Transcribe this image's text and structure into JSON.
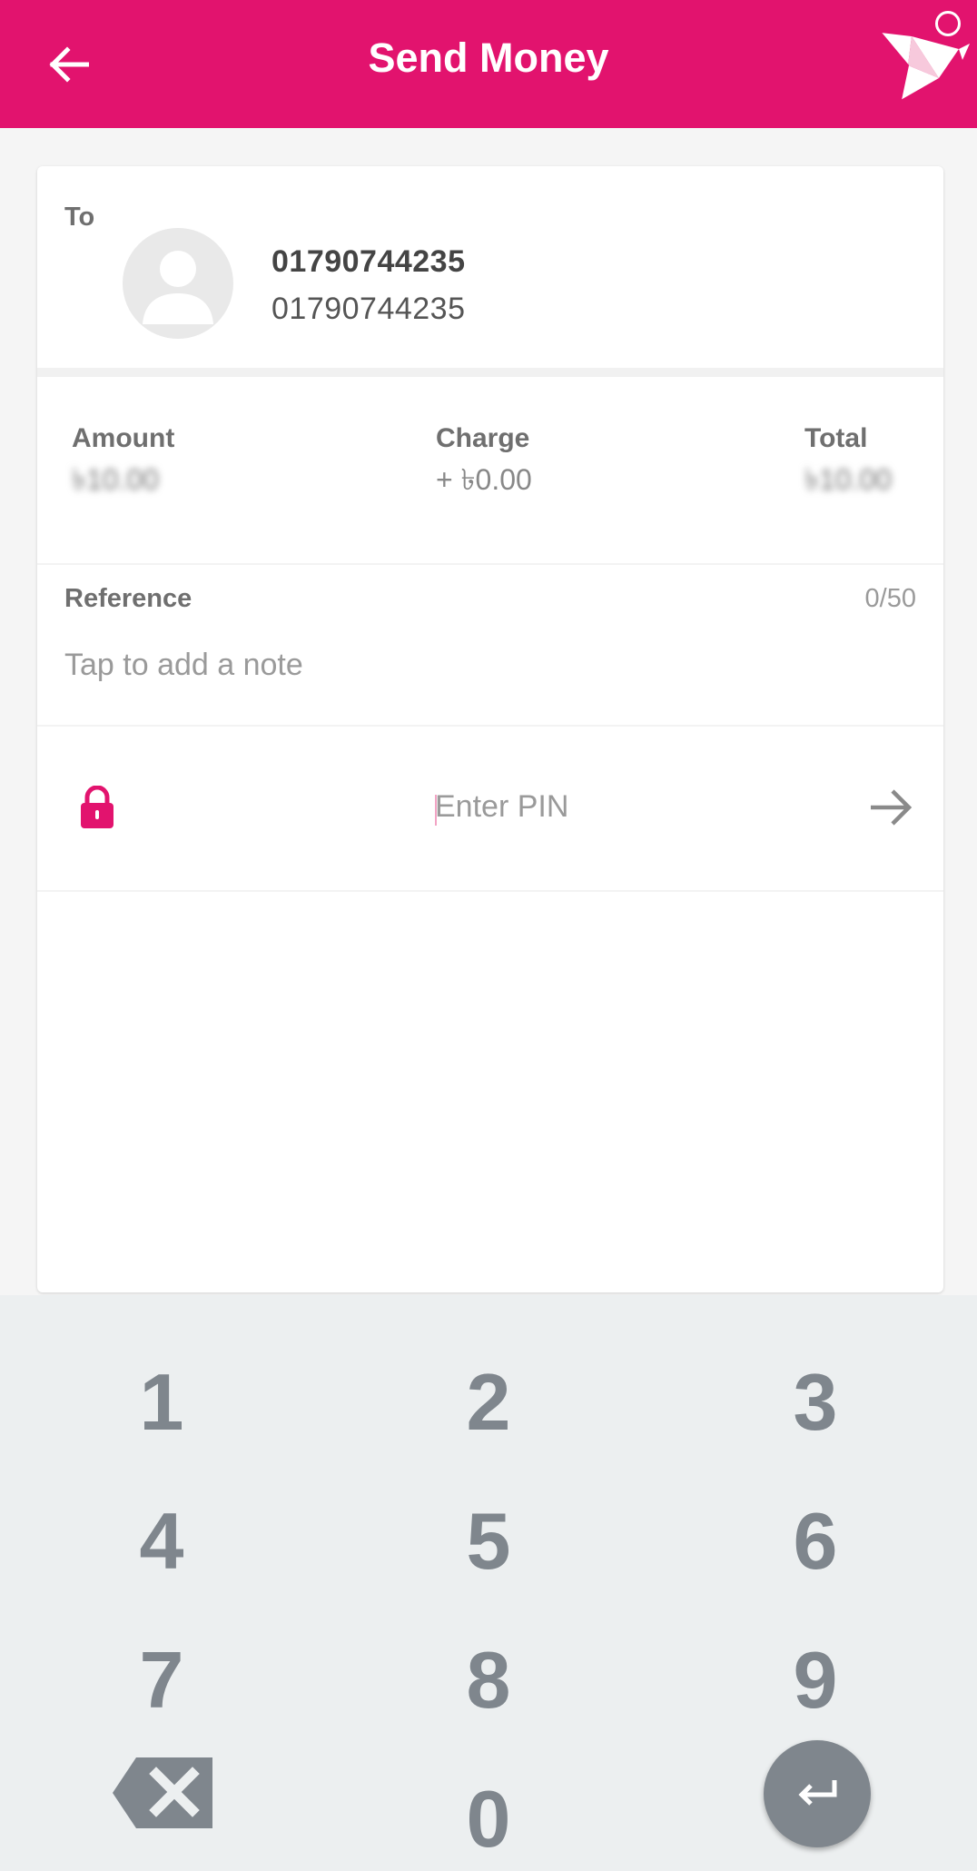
{
  "appbar": {
    "title": "Send Money",
    "back_icon": "arrow-left-icon",
    "logo_icon": "bkash-bird-logo",
    "background": "#e2136e"
  },
  "recipient": {
    "to_label": "To",
    "name": "01790744235",
    "number": "01790744235",
    "avatar_icon": "person-avatar-icon"
  },
  "summary": {
    "amount_label": "Amount",
    "amount_value": "৳10.00",
    "charge_label": "Charge",
    "charge_value": "+ ৳0.00",
    "total_label": "Total",
    "total_value": "৳10.00"
  },
  "reference": {
    "label": "Reference",
    "counter": "0/50",
    "placeholder": "Tap to add a note"
  },
  "pin": {
    "placeholder": "Enter PIN",
    "lock_icon": "lock-icon",
    "submit_icon": "arrow-right-icon",
    "accent": "#e2136e"
  },
  "keypad": {
    "keys": [
      "1",
      "2",
      "3",
      "4",
      "5",
      "6",
      "7",
      "8",
      "9",
      "0"
    ],
    "backspace_icon": "backspace-icon",
    "enter_icon": "enter-icon",
    "background": "#eceff0",
    "key_color": "#7f868d"
  }
}
